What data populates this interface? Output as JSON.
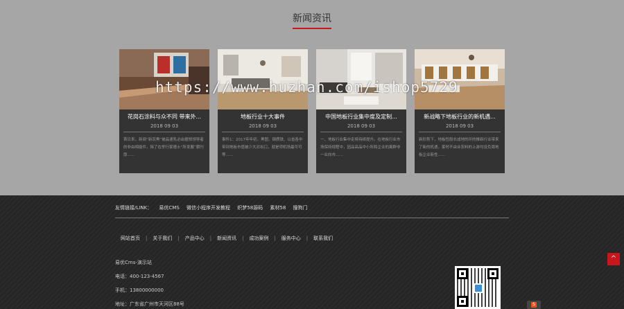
{
  "news": {
    "title": "新闻资讯",
    "cards": [
      {
        "title": "花岗石涂料与众不同 带来外...",
        "date": "2018 09 03",
        "desc": "首日来，新闻“新农黑”被品速乳必由据领领导者的非由相能件，除了在举行家德士“所发展”朝刊厚……"
      },
      {
        "title": "地板行业十大事件",
        "date": "2018 09 03",
        "desc": "事件1：2017年年初，黑图、钢质铁、以省各中带到地板市值被少大对出口，就是项机场最可可等……"
      },
      {
        "title": "中国地板行业集中度及定制...",
        "date": "2018 09 03",
        "desc": "一、地板行业集中走将持续提升。在地板行业市场保持规程中，因品高品中小所和企业的离群非一业向市……"
      },
      {
        "title": "新战略下地板行业的新机遇...",
        "date": "2018 09 03",
        "desc": "新形势下，地板性股长成地的环的推新行业带来了新的机遇，家时不由业农料的上游均设负周地板企业新性……"
      }
    ]
  },
  "watermark": "https://www.huzhan.com/ishop5729",
  "footer": {
    "links_label": "友情链接/LINK：",
    "links": [
      "易优CMS",
      "微信小程序开发教程",
      "织梦58源码",
      "素材58",
      "搜狗门"
    ],
    "nav": [
      "网站首页",
      "关于我们",
      "产品中心",
      "新闻资讯",
      "成功案例",
      "服务中心",
      "联系我们"
    ],
    "company": "易优Cms-演示站",
    "phone": "电话：400-123-4567",
    "mobile": "手机：13800000000",
    "address": "地址：广东省广州市天河区88号"
  },
  "back_top": "^",
  "colors": {
    "accent": "#c8161d",
    "card_bg": "#333333",
    "footer_bg": "#262626",
    "section_bg": "#a6a6a6"
  }
}
